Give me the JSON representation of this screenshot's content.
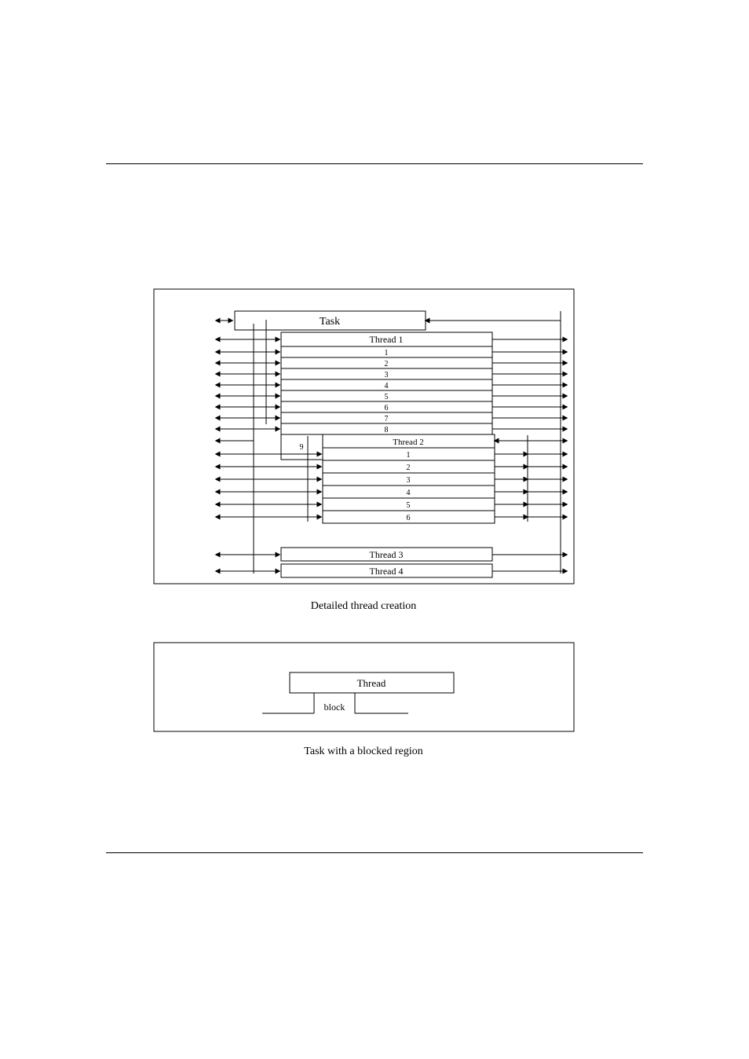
{
  "figure1": {
    "title": "Detailed thread creation",
    "task_label": "Task",
    "thread1": {
      "label": "Thread 1",
      "sub": [
        "1",
        "2",
        "3",
        "4",
        "5",
        "6",
        "7",
        "8",
        "9"
      ]
    },
    "thread2": {
      "label": "Thread 2",
      "sub": [
        "1",
        "2",
        "3",
        "4",
        "5",
        "6"
      ]
    },
    "thread3": "Thread 3",
    "thread4": "Thread 4"
  },
  "figure2": {
    "title": "Task with a blocked region",
    "thread_label": "Thread",
    "block_label": "block"
  }
}
